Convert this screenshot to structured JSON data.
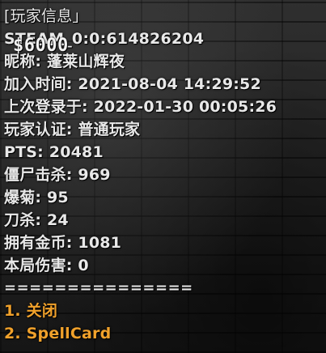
{
  "hud": {
    "money": "$6000"
  },
  "panel": {
    "title": "[玩家信息」",
    "steam": "STEAM_0:0:614826204",
    "nickname": "昵称: 蓬莱山辉夜",
    "join_time": "加入时间: 2021-08-04 14:29:52",
    "last_login": "上次登录于: 2022-01-30 00:05:26",
    "auth": "玩家认证: 普通玩家",
    "pts": "PTS: 20481",
    "zombie_kills": "僵尸击杀: 969",
    "headshots": "爆菊: 95",
    "knife_kills": "刀杀: 24",
    "coins": "拥有金币: 1081",
    "round_damage": "本局伤害: 0",
    "separator": "==============="
  },
  "options": [
    {
      "number": "1.",
      "label": "关闭"
    },
    {
      "number": "2.",
      "label": "SpellCard"
    }
  ]
}
